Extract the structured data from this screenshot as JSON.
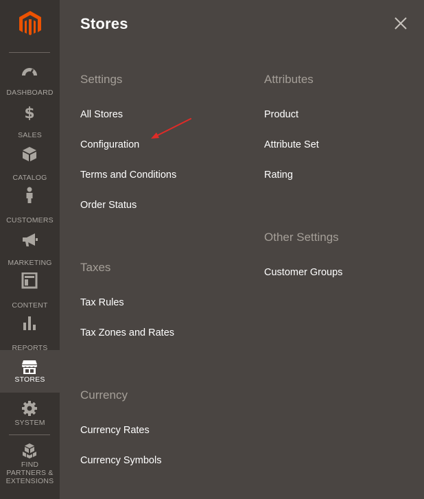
{
  "colors": {
    "sidebar_bg": "#373330",
    "panel_bg": "#4a4542",
    "active_item_bg": "#4a4542",
    "section_title": "#a59f98",
    "link": "#ffffff",
    "logo_orange": "#eb5202",
    "annotation_arrow": "#e02b27"
  },
  "sidebar": {
    "logo_icon": "magento-logo-icon",
    "items": [
      {
        "label": "DASHBOARD",
        "icon": "dashboard-icon"
      },
      {
        "label": "SALES",
        "icon": "dollar-icon"
      },
      {
        "label": "CATALOG",
        "icon": "box-icon"
      },
      {
        "label": "CUSTOMERS",
        "icon": "person-icon"
      },
      {
        "label": "MARKETING",
        "icon": "megaphone-icon"
      },
      {
        "label": "CONTENT",
        "icon": "layout-icon"
      },
      {
        "label": "REPORTS",
        "icon": "bar-chart-icon"
      },
      {
        "label": "STORES",
        "icon": "storefront-icon",
        "active": true
      },
      {
        "label": "SYSTEM",
        "icon": "gear-icon"
      },
      {
        "label": "FIND PARTNERS & EXTENSIONS",
        "icon": "cubes-icon"
      }
    ]
  },
  "panel": {
    "title": "Stores",
    "close_icon": "close-icon",
    "sections": {
      "settings": {
        "title": "Settings",
        "links": [
          "All Stores",
          "Configuration",
          "Terms and Conditions",
          "Order Status"
        ]
      },
      "taxes": {
        "title": "Taxes",
        "links": [
          "Tax Rules",
          "Tax Zones and Rates"
        ]
      },
      "currency": {
        "title": "Currency",
        "links": [
          "Currency Rates",
          "Currency Symbols"
        ]
      },
      "attributes": {
        "title": "Attributes",
        "links": [
          "Product",
          "Attribute Set",
          "Rating"
        ]
      },
      "other_settings": {
        "title": "Other Settings",
        "links": [
          "Customer Groups"
        ]
      }
    }
  }
}
